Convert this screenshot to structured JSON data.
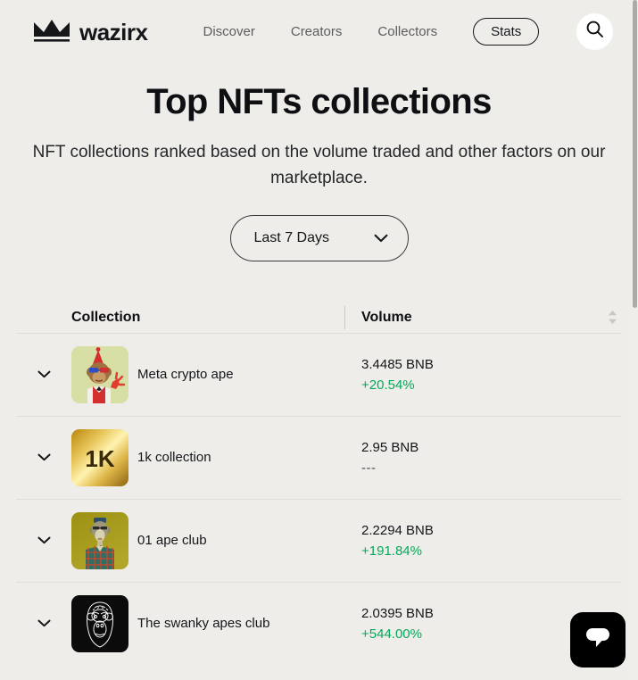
{
  "nav": {
    "brand": "wazirx",
    "brand_icon": "wazirx-crown-logo",
    "links": [
      {
        "label": "Discover"
      },
      {
        "label": "Creators"
      },
      {
        "label": "Collectors"
      }
    ],
    "active_pill": "Stats",
    "search_icon": "search-icon"
  },
  "hero": {
    "title": "Top NFTs collections",
    "subtitle": "NFT collections ranked based on the volume traded and other factors on our marketplace."
  },
  "filter": {
    "selected": "Last 7 Days",
    "caret_icon": "chevron-down-icon"
  },
  "table": {
    "headers": {
      "collection": "Collection",
      "volume": "Volume"
    },
    "sort_icon": "sort-updown-icon",
    "row_caret_icon": "chevron-down-icon",
    "rows": [
      {
        "name": "Meta crypto ape",
        "thumb": "ape-party-hat-3d-glasses",
        "volume": "3.4485 BNB",
        "change": "+20.54%",
        "change_state": "up"
      },
      {
        "name": "1k collection",
        "thumb": "gold-1k-card",
        "volume": "2.95 BNB",
        "change": "---",
        "change_state": "flat"
      },
      {
        "name": "01 ape club",
        "thumb": "ape-plaid-shirt-olive",
        "volume": "2.2294 BNB",
        "change": "+191.84%",
        "change_state": "up"
      },
      {
        "name": "The swanky apes club",
        "thumb": "ape-line-art-black",
        "volume": "2.0395 BNB",
        "change": "+544.00%",
        "change_state": "up"
      }
    ]
  },
  "chat_widget": {
    "icon": "chat-bubble-icon"
  },
  "colors": {
    "background": "#EEEDE9",
    "text": "#15161A",
    "positive": "#06A85B",
    "divider": "#DFDEDA"
  }
}
